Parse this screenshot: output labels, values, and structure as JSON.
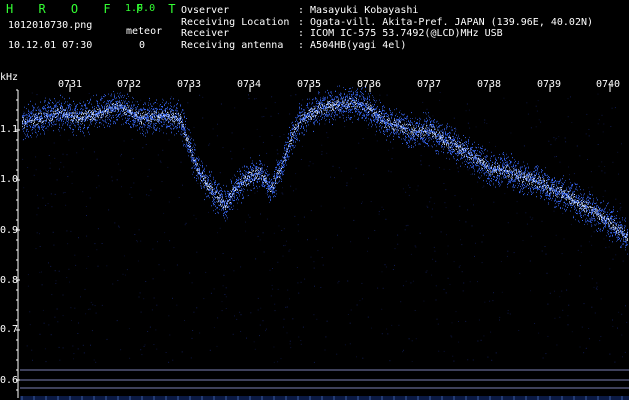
{
  "app": {
    "title": "H R O F F T",
    "version": "1.0.0"
  },
  "file": {
    "name": "1012010730.png",
    "datetime": "10.12.01 07:30"
  },
  "meteor": {
    "label": "meteor",
    "count": "0"
  },
  "info": [
    {
      "key": "Ovserver",
      "value": ": Masayuki Kobayashi"
    },
    {
      "key": "Receiving Location",
      "value": ": Ogata-vill. Akita-Pref. JAPAN (139.96E, 40.02N)"
    },
    {
      "key": "Receiver",
      "value": ": ICOM IC-575 53.7492(@LCD)MHz USB"
    },
    {
      "key": "Receiving antenna",
      "value": ": A504HB(yagi 4el)"
    }
  ],
  "axis": {
    "y_unit": "kHz",
    "time_ticks": [
      "0731",
      "0732",
      "0733",
      "0734",
      "0735",
      "0736",
      "0737",
      "0738",
      "0739",
      "0740"
    ],
    "freq_ticks": [
      "1.1",
      "1.0",
      "0.9",
      "0.8",
      "0.7",
      "0.6"
    ]
  },
  "colors": {
    "bg": "#000000",
    "signal": "#3a6bff",
    "signal_hot": "#cfe0ff",
    "guide": "#7b7fb5",
    "title": "#33ff33"
  }
}
